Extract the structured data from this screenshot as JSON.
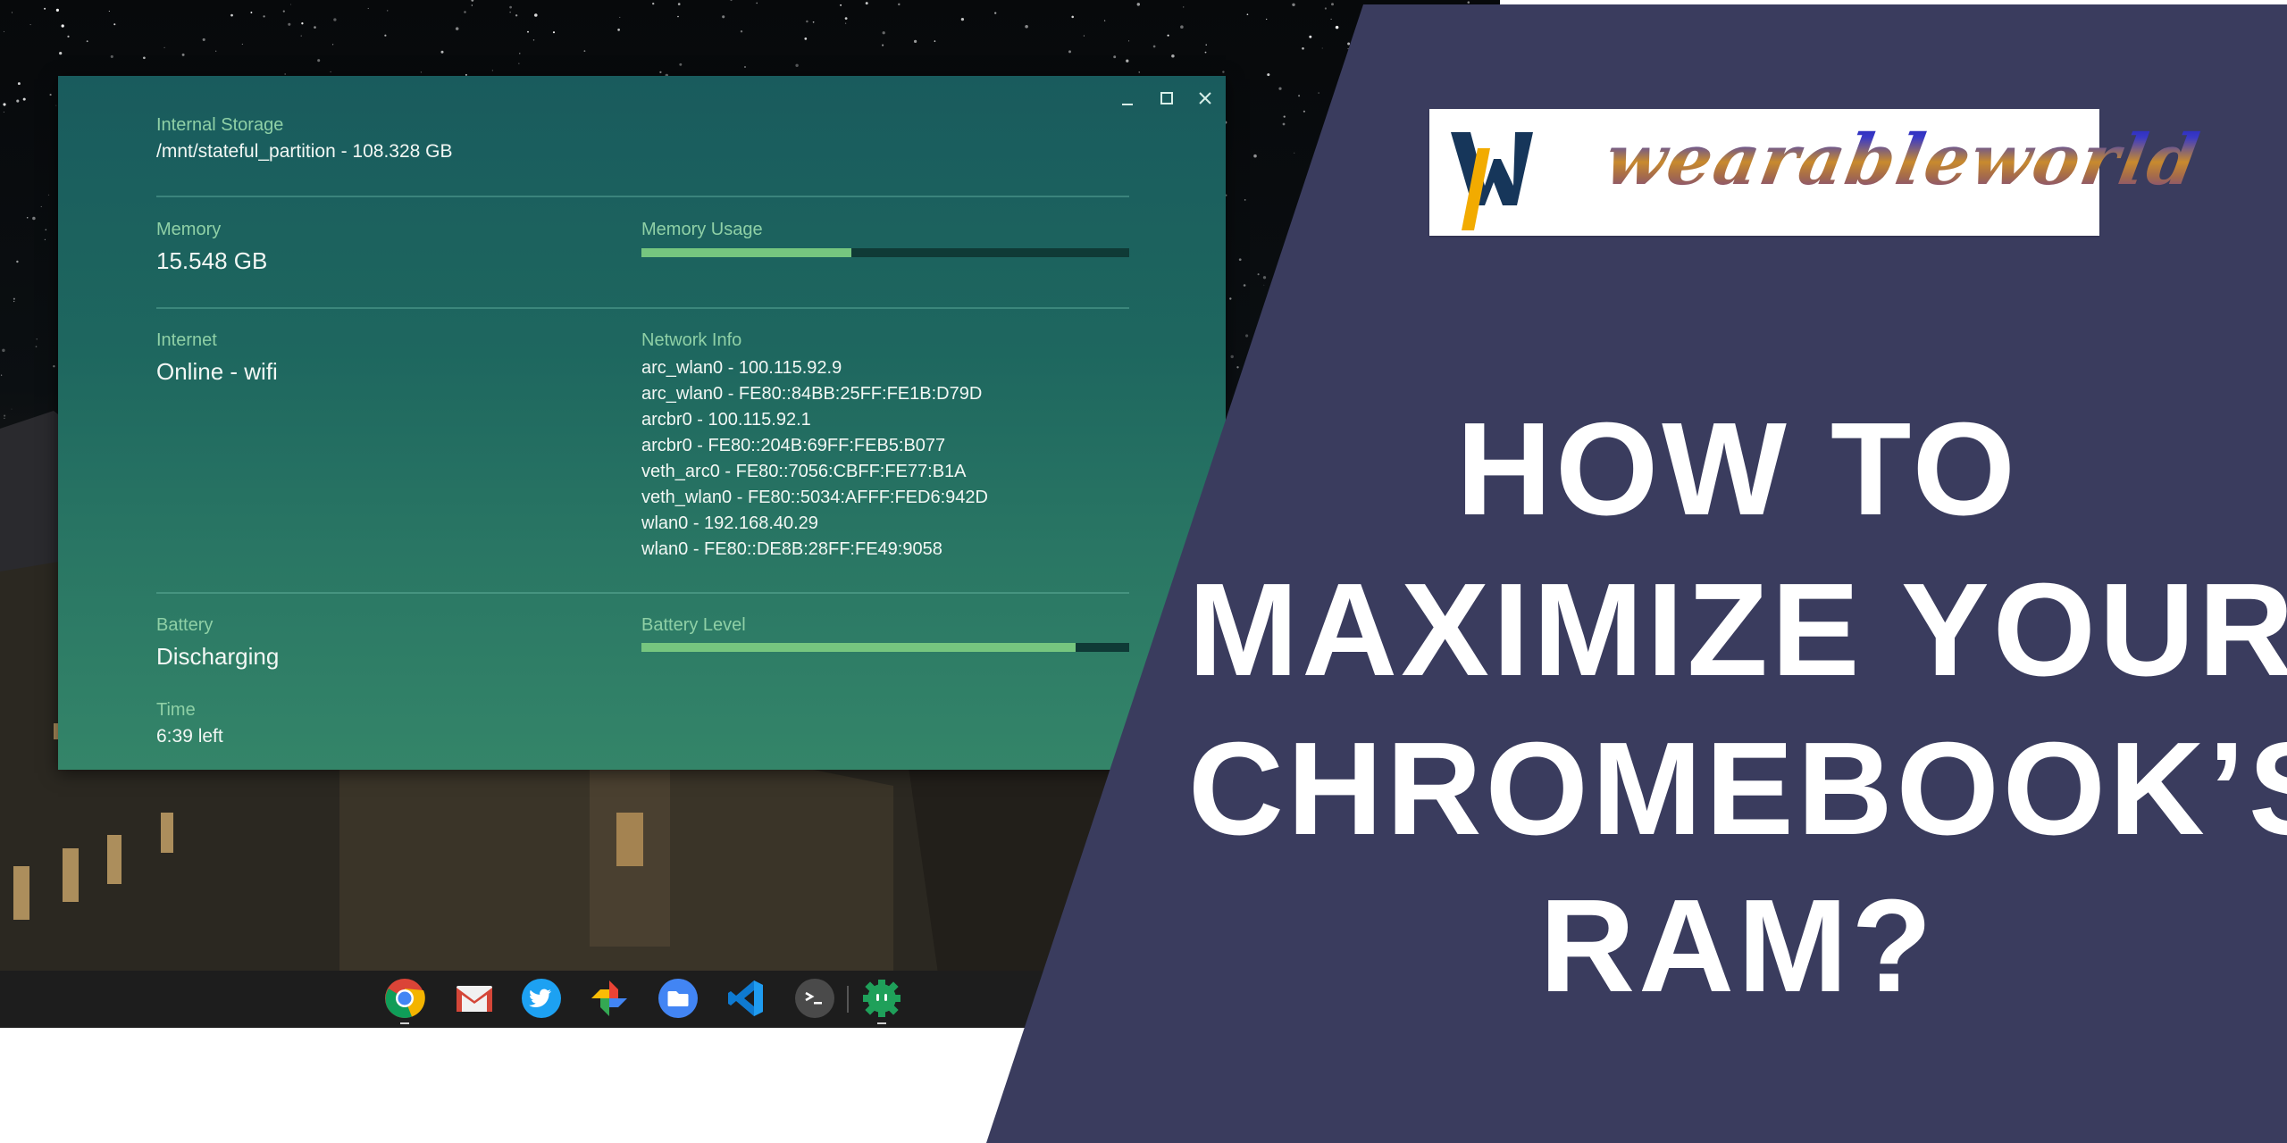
{
  "window": {
    "controls": {
      "minimize": "minimize",
      "maximize": "maximize",
      "close": "close"
    },
    "storage": {
      "label": "Internal Storage",
      "value": "/mnt/stateful_partition - 108.328 GB"
    },
    "memory": {
      "label": "Memory",
      "value": "15.548 GB",
      "usage_label": "Memory Usage",
      "usage_percent": 43
    },
    "internet": {
      "label": "Internet",
      "value": "Online - wifi"
    },
    "network": {
      "label": "Network Info",
      "lines": [
        "arc_wlan0 - 100.115.92.9",
        "arc_wlan0 - FE80::84BB:25FF:FE1B:D79D",
        "arcbr0 - 100.115.92.1",
        "arcbr0 - FE80::204B:69FF:FEB5:B077",
        "veth_arc0 - FE80::7056:CBFF:FE77:B1A",
        "veth_wlan0 - FE80::5034:AFFF:FED6:942D",
        "wlan0 - 192.168.40.29",
        "wlan0 - FE80::DE8B:28FF:FE49:9058"
      ]
    },
    "battery": {
      "label": "Battery",
      "value": "Discharging",
      "level_label": "Battery Level",
      "level_percent": 89
    },
    "time": {
      "label": "Time",
      "value": "6:39 left"
    }
  },
  "shelf": {
    "apps": [
      {
        "name": "Chrome",
        "icon": "chrome-icon",
        "running": true
      },
      {
        "name": "Gmail",
        "icon": "gmail-icon",
        "running": false
      },
      {
        "name": "Twitter",
        "icon": "twitter-icon",
        "running": false
      },
      {
        "name": "Google Photos",
        "icon": "photos-icon",
        "running": false
      },
      {
        "name": "Files",
        "icon": "folder-icon",
        "running": false
      },
      {
        "name": "Visual Studio Code",
        "icon": "vscode-icon",
        "running": false
      },
      {
        "name": "Terminal",
        "icon": "terminal-icon",
        "running": false
      },
      {
        "name": "Cog",
        "icon": "green-gear-icon",
        "running": true
      }
    ]
  },
  "promo": {
    "logo_text": "wearableworld",
    "headline": [
      "HOW TO",
      "MAXIMIZE YOUR",
      "CHROMEBOOK’S",
      "RAM?"
    ],
    "colors": {
      "panel": "#3a3c5e",
      "logo_navy": "#16365a",
      "logo_yellow": "#f2ab00",
      "headline": "#ffffff"
    }
  }
}
